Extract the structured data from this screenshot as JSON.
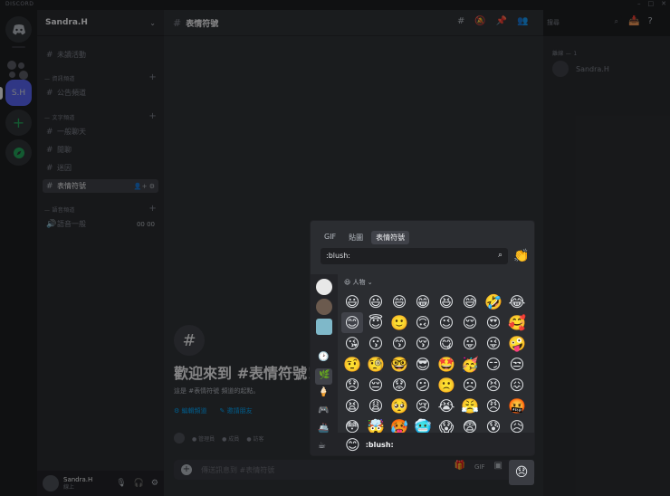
{
  "window": {
    "app_title": "DISCORD",
    "controls": [
      "–",
      "□",
      "✕"
    ]
  },
  "rail": {
    "home_icon": "discord-logo-icon",
    "user_server": "S.H",
    "add_icon": "+",
    "explore_icon": "compass-icon"
  },
  "guild": {
    "name": "Sandra.H",
    "chevron": "⌄"
  },
  "sidebar": {
    "top_channel": {
      "icon": "#",
      "label": "未讀活動"
    },
    "cat_1": "— 資訊頻道",
    "ch_1": {
      "icon": "#",
      "label": "公告頻道"
    },
    "cat_2": "— 文字頻道",
    "ch_2": {
      "icon": "#",
      "label": "一般聊天"
    },
    "ch_3": {
      "icon": "#",
      "label": "閒聊"
    },
    "ch_4": {
      "icon": "#",
      "label": "迷因"
    },
    "ch_5": {
      "icon": "#",
      "label": "表情符號",
      "right": "👤+ ⚙"
    },
    "cat_3": "— 語音頻道",
    "ch_6": {
      "icon": "🔊",
      "label": "語音一般",
      "right": "00 00"
    },
    "plus": "+"
  },
  "user_panel": {
    "name": "Sandra.H",
    "status": "線上",
    "mic": "🎙",
    "headset": "🎧",
    "settings": "⚙"
  },
  "channel": {
    "hash": "#",
    "title": "表情符號"
  },
  "toolbar": {
    "threads": "#",
    "mute": "🔕",
    "pin": "📌",
    "members": "👥",
    "inbox": "📥",
    "help": "?"
  },
  "search": {
    "placeholder": "搜尋",
    "icon": "⌕"
  },
  "members": {
    "category": "離線 — 1",
    "member_name": "Sandra.H"
  },
  "welcome": {
    "icon": "#",
    "title": "歡迎來到 #表情符號！",
    "subtitle": "這是 #表情符號 頻道的起點。",
    "action_1": "⚙ 編輯頻道",
    "action_2": "✎ 邀請朋友"
  },
  "message_row": {
    "items": [
      "● 管理員",
      "● 成員",
      "● 訪客"
    ]
  },
  "composer": {
    "plus": "+",
    "placeholder": "傳送訊息到 #表情符號",
    "gift": "🎁",
    "gif": "GIF",
    "sticker": "▣",
    "emoji": "😞"
  },
  "picker": {
    "tab_gif": "GIF",
    "tab_sticker": "貼圖",
    "tab_emoji": "表情符號",
    "search_value": ":blush:",
    "search_icon": "⌕",
    "skin_tone": "👏",
    "category_label": "😃 人物 ⌄",
    "sidebar_icons": [
      "🕑",
      "🌿",
      "🍦",
      "🎮",
      "🚢",
      "☕"
    ],
    "emojis": [
      "😃",
      "😃",
      "😄",
      "😁",
      "😆",
      "😅",
      "🤣",
      "😂",
      "😊",
      "😇",
      "🙂",
      "🙃",
      "😉",
      "😌",
      "😍",
      "🥰",
      "😘",
      "😗",
      "😙",
      "😚",
      "😋",
      "😛",
      "😜",
      "🤪",
      "🤨",
      "🧐",
      "🤓",
      "😎",
      "🤩",
      "🥳",
      "😏",
      "😒",
      "😞",
      "😔",
      "😟",
      "😕",
      "🙁",
      "☹",
      "😣",
      "😖",
      "😫",
      "😩",
      "🥺",
      "😢",
      "😭",
      "😤",
      "😠",
      "🤬",
      "😳",
      "🤯",
      "🥵",
      "🥶",
      "😱",
      "😨",
      "😰",
      "😥"
    ],
    "preview_emoji": "😊",
    "preview_name": ":blush:"
  }
}
